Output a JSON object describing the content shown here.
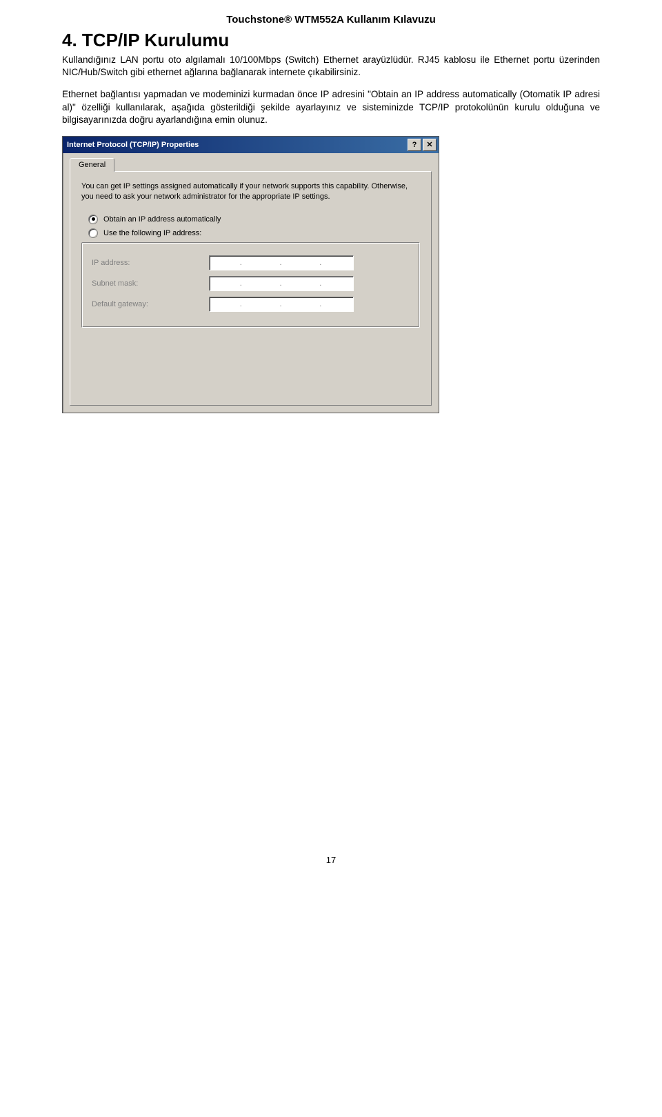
{
  "doc_header": "Touchstone® WTM552A Kullanım Kılavuzu",
  "section_heading": "4.  TCP/IP Kurulumu",
  "paragraph1": "Kullandığınız LAN portu oto algılamalı 10/100Mbps (Switch) Ethernet arayüzlüdür. RJ45 kablosu ile Ethernet portu üzerinden NIC/Hub/Switch gibi ethernet ağlarına bağlanarak internete çıkabilirsiniz.",
  "paragraph2": "Ethernet bağlantısı yapmadan ve modeminizi kurmadan önce IP adresini \"Obtain an IP address automatically (Otomatik IP adresi al)\" özelliği kullanılarak, aşağıda gösterildiği şekilde ayarlayınız ve sisteminizde TCP/IP protokolünün kurulu olduğuna ve bilgisayarınızda doğru ayarlandığına emin olunuz.",
  "dialog": {
    "title": "Internet Protocol (TCP/IP) Properties",
    "help_btn": "?",
    "close_btn": "✕",
    "tab_label": "General",
    "description": "You can get IP settings assigned automatically if your network supports this capability. Otherwise, you need to ask your network administrator for the appropriate IP settings.",
    "radio1": "Obtain an IP address automatically",
    "radio2": "Use the following IP address:",
    "field_ip": "IP address:",
    "field_subnet": "Subnet mask:",
    "field_gateway": "Default gateway:"
  },
  "page_number": "17"
}
